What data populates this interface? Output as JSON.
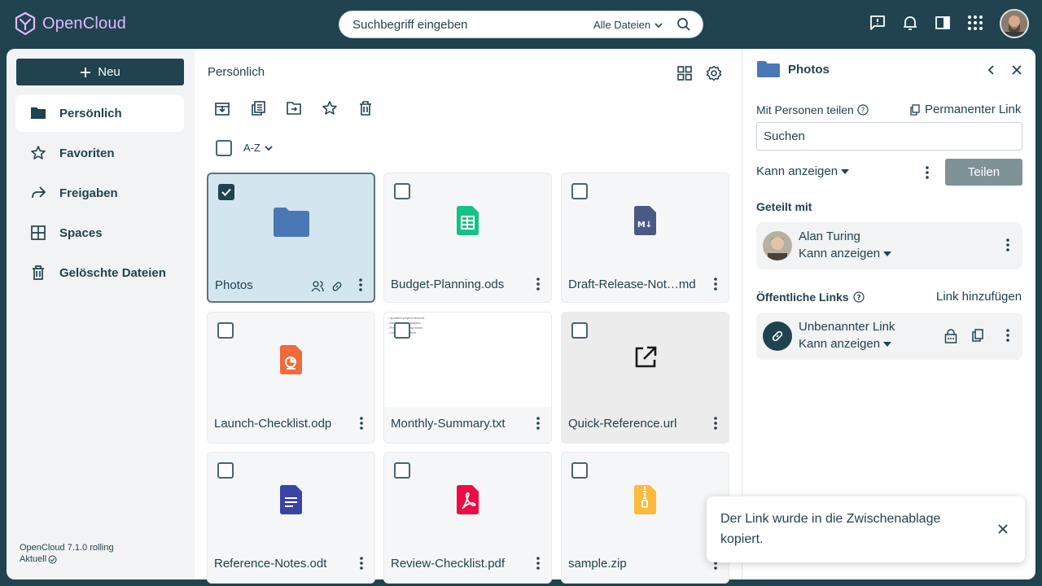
{
  "app": {
    "name": "OpenCloud",
    "version": "OpenCloud 7.1.0 rolling",
    "status": "Aktuell"
  },
  "search": {
    "placeholder": "Suchbegriff eingeben",
    "scope": "Alle Dateien"
  },
  "topbar": {
    "icons": [
      "feedback-icon",
      "notifications-icon",
      "sidebar-toggle-icon",
      "app-switcher-icon"
    ]
  },
  "sidebar": {
    "new_label": "Neu",
    "items": [
      {
        "label": "Persönlich",
        "icon": "folder-icon",
        "active": true
      },
      {
        "label": "Favoriten",
        "icon": "star-icon",
        "active": false
      },
      {
        "label": "Freigaben",
        "icon": "share-icon",
        "active": false
      },
      {
        "label": "Spaces",
        "icon": "spaces-icon",
        "active": false
      },
      {
        "label": "Gelöschte Dateien",
        "icon": "trash-icon",
        "active": false
      }
    ]
  },
  "main": {
    "breadcrumb": "Persönlich",
    "sort_label": "A-Z",
    "files": [
      {
        "name": "Photos",
        "type": "folder",
        "selected": true
      },
      {
        "name": "Budget-Planning.ods",
        "type": "spreadsheet"
      },
      {
        "name": "Draft-Release-Not…md",
        "type": "markdown"
      },
      {
        "name": "Launch-Checklist.odp",
        "type": "presentation"
      },
      {
        "name": "Monthly-Summary.txt",
        "type": "text"
      },
      {
        "name": "Quick-Reference.url",
        "type": "url"
      },
      {
        "name": "Reference-Notes.odt",
        "type": "document"
      },
      {
        "name": "Review-Checklist.pdf",
        "type": "pdf"
      },
      {
        "name": "sample.zip",
        "type": "archive"
      }
    ],
    "txt_preview_lines": [
      "- Updated project rescord",
      "- Added new examples",
      "- Prepare meeting notes",
      "- Consider workflow"
    ]
  },
  "panel": {
    "title": "Photos",
    "share_people_label": "Mit Personen teilen",
    "permanent_link_label": "Permanenter Link",
    "search_placeholder": "Suchen",
    "permission_label": "Kann anzeigen",
    "share_button": "Teilen",
    "shared_with_label": "Geteilt mit",
    "shared_user": {
      "name": "Alan Turing",
      "permission": "Kann anzeigen"
    },
    "public_links_label": "Öffentliche Links",
    "add_link_label": "Link hinzufügen",
    "public_link": {
      "name": "Unbenannter Link",
      "permission": "Kann anzeigen"
    }
  },
  "toast": {
    "message": "Der Link wurde in die Zwischenablage kopiert."
  },
  "colors": {
    "brand": "#20434f",
    "logo": "#e2baff",
    "folder": "#4a78b4",
    "sheet": "#15c286",
    "pres": "#ee6b3b",
    "doc": "#3b44a6",
    "pdf": "#ec0d47",
    "zip": "#fcba3f",
    "md": "#4a5a86"
  }
}
